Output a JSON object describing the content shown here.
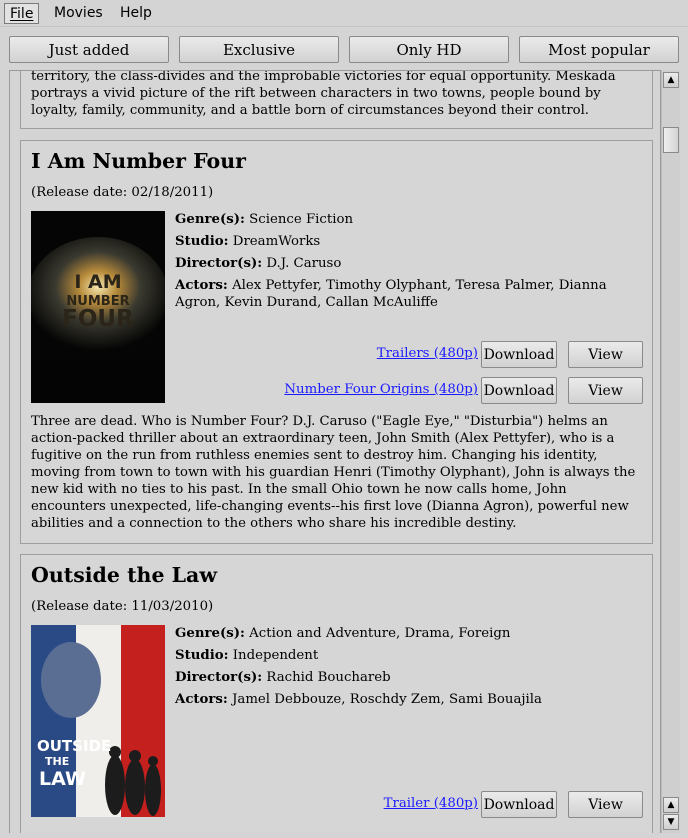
{
  "menu": {
    "file": "File",
    "movies": "Movies",
    "help": "Help"
  },
  "filters": [
    "Just added",
    "Exclusive",
    "Only HD",
    "Most popular"
  ],
  "movies": [
    {
      "description": "territory, the class-divides and the improbable victories for equal opportunity. Meskada portrays a vivid picture of the rift between characters in two towns, people bound by loyalty, family, community, and a battle born of circumstances beyond their control."
    },
    {
      "title": "I Am Number Four",
      "release": "(Release date: 02/18/2011)",
      "poster_text": [
        "I AM",
        "NUMBER",
        "FOUR"
      ],
      "genre_label": "Genre(s):",
      "genre": "Science Fiction",
      "studio_label": "Studio:",
      "studio": "DreamWorks",
      "director_label": "Director(s):",
      "director": "D.J. Caruso",
      "actors_label": "Actors:",
      "actors": "Alex Pettyfer, Timothy Olyphant, Teresa Palmer, Dianna Agron, Kevin Durand, Callan McAuliffe",
      "links": [
        {
          "label": "Trailers (480p)",
          "download": "Download",
          "view": "View"
        },
        {
          "label": "Number Four Origins (480p)",
          "download": "Download",
          "view": "View"
        }
      ],
      "description": "Three are dead. Who is Number Four? D.J. Caruso (\"Eagle Eye,\" \"Disturbia\") helms an action-packed thriller about an extraordinary teen, John Smith (Alex Pettyfer), who is a fugitive on the run from ruthless enemies sent to destroy him. Changing his identity, moving from town to town with his guardian Henri (Timothy Olyphant), John is always the new kid with no ties to his past. In the small Ohio town he now calls home, John encounters unexpected, life-changing events--his first love (Dianna Agron), powerful new abilities and a connection to the others who share his incredible destiny."
    },
    {
      "title": "Outside the Law",
      "release": "(Release date: 11/03/2010)",
      "poster_text": [
        "OUTSIDE",
        "THE",
        "LAW"
      ],
      "genre_label": "Genre(s):",
      "genre": "Action and Adventure, Drama, Foreign",
      "studio_label": "Studio:",
      "studio": "Independent",
      "director_label": "Director(s):",
      "director": "Rachid Bouchareb",
      "actors_label": "Actors:",
      "actors": "Jamel Debbouze, Roschdy Zem, Sami Bouajila",
      "links": [
        {
          "label": "Trailer (480p)",
          "download": "Download",
          "view": "View"
        }
      ]
    }
  ],
  "colors": {
    "link": "#1a1aff",
    "background": "#d4d4d4"
  },
  "icons": {
    "scroll_up": "arrow-up-icon",
    "scroll_down": "arrow-down-icon"
  }
}
